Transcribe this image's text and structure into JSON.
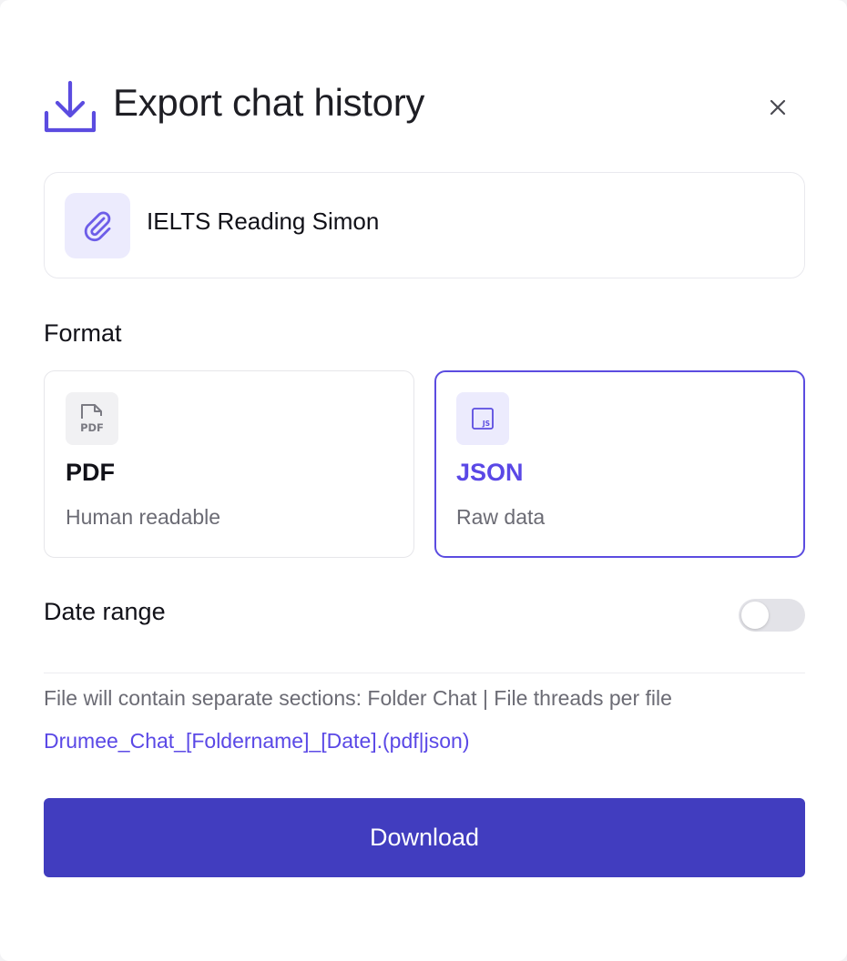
{
  "dialog": {
    "title": "Export chat history",
    "close_icon": "close-icon",
    "header_icon": "download-icon"
  },
  "file": {
    "name": "IELTS Reading Simon",
    "icon": "paperclip-icon"
  },
  "format": {
    "label": "Format",
    "options": [
      {
        "title": "PDF",
        "subtitle": "Human readable",
        "icon": "pdf-file-icon",
        "icon_text": "PDF",
        "selected": false
      },
      {
        "title": "JSON",
        "subtitle": "Raw data",
        "icon": "json-file-icon",
        "icon_text": "JS",
        "selected": true
      }
    ]
  },
  "date_range": {
    "label": "Date range",
    "enabled": false
  },
  "info": {
    "description": "File will contain separate sections: Folder Chat | File threads per file",
    "filename_pattern": "Drumee_Chat_[Foldername]_[Date].(pdf|json)"
  },
  "actions": {
    "download_label": "Download"
  },
  "colors": {
    "accent": "#5b4ce0",
    "button": "#413dbf",
    "link": "#5a48e6"
  }
}
